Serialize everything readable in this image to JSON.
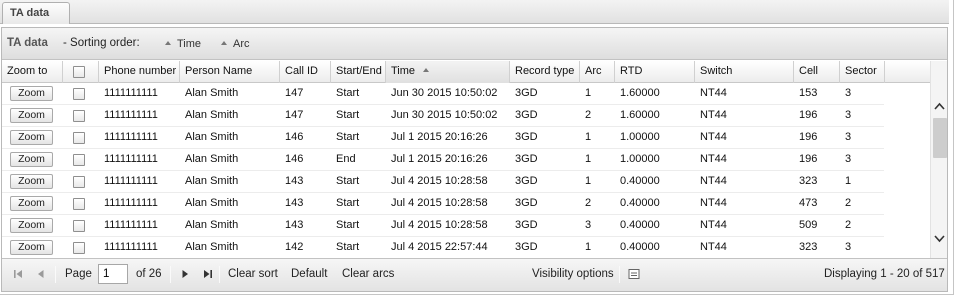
{
  "tab": {
    "label": "TA data"
  },
  "sortbar": {
    "title": "TA data",
    "order_label": "- Sorting order:",
    "chips": [
      {
        "label": "Time"
      },
      {
        "label": "Arc"
      }
    ]
  },
  "columns": [
    "Zoom to",
    "",
    "Phone number",
    "Person Name",
    "Call ID",
    "Start/End",
    "Time",
    "Record type",
    "Arc",
    "RTD",
    "Switch",
    "Cell",
    "Sector"
  ],
  "sorted_column": "Time",
  "zoom_label": "Zoom",
  "rows": [
    [
      "1111111111",
      "Alan Smith",
      "147",
      "Start",
      "Jun 30 2015 10:50:02",
      "3GD",
      "1",
      "1.60000",
      "NT44",
      "153",
      "3"
    ],
    [
      "1111111111",
      "Alan Smith",
      "147",
      "Start",
      "Jun 30 2015 10:50:02",
      "3GD",
      "2",
      "1.60000",
      "NT44",
      "196",
      "3"
    ],
    [
      "1111111111",
      "Alan Smith",
      "146",
      "Start",
      "Jul 1 2015 20:16:26",
      "3GD",
      "1",
      "1.00000",
      "NT44",
      "196",
      "3"
    ],
    [
      "1111111111",
      "Alan Smith",
      "146",
      "End",
      "Jul 1 2015 20:16:26",
      "3GD",
      "1",
      "1.00000",
      "NT44",
      "196",
      "3"
    ],
    [
      "1111111111",
      "Alan Smith",
      "143",
      "Start",
      "Jul 4 2015 10:28:58",
      "3GD",
      "1",
      "0.40000",
      "NT44",
      "323",
      "1"
    ],
    [
      "1111111111",
      "Alan Smith",
      "143",
      "Start",
      "Jul 4 2015 10:28:58",
      "3GD",
      "2",
      "0.40000",
      "NT44",
      "473",
      "2"
    ],
    [
      "1111111111",
      "Alan Smith",
      "143",
      "Start",
      "Jul 4 2015 10:28:58",
      "3GD",
      "3",
      "0.40000",
      "NT44",
      "509",
      "2"
    ],
    [
      "1111111111",
      "Alan Smith",
      "142",
      "Start",
      "Jul 4 2015 22:57:44",
      "3GD",
      "1",
      "0.40000",
      "NT44",
      "323",
      "3"
    ]
  ],
  "pager": {
    "page_label": "Page",
    "page_value": "1",
    "of_label": "of 26",
    "clear_sort": "Clear sort",
    "default": "Default",
    "clear_arcs": "Clear arcs",
    "visibility": "Visibility options",
    "displaying": "Displaying 1 - 20 of 517"
  }
}
